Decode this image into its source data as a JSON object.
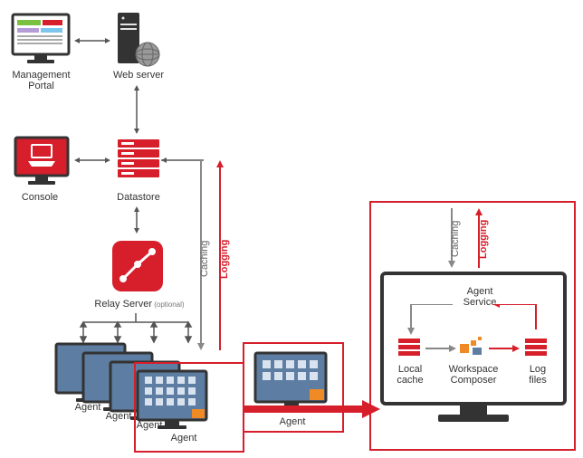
{
  "nodes": {
    "management_portal": "Management\nPortal",
    "web_server": "Web server",
    "console": "Console",
    "datastore": "Datastore",
    "relay_server": "Relay Server",
    "relay_server_suffix": " (optional)",
    "agent": "Agent"
  },
  "detail": {
    "agent_service": "Agent\nService",
    "local_cache": "Local\ncache",
    "workspace_composer": "Workspace\nComposer",
    "log_files": "Log\nfiles"
  },
  "labels": {
    "caching": "Caching",
    "logging": "Logging"
  },
  "colors": {
    "accent": "#d71e2b",
    "gray": "#555"
  }
}
